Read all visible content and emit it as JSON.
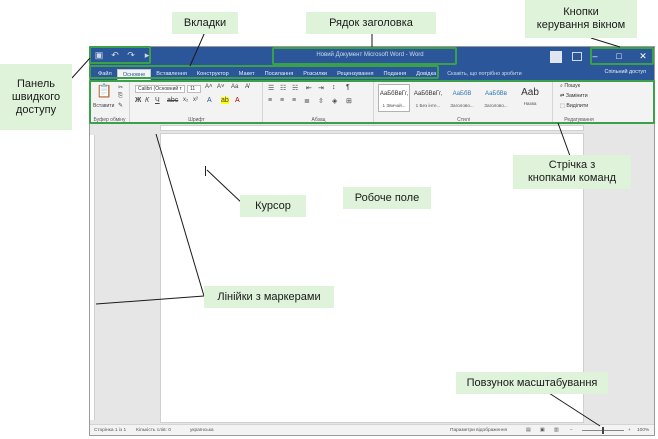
{
  "window": {
    "title": "Новий Документ Microsoft Word  -  Word",
    "tell_me": "Скажіть, що потрібно зробити",
    "share": "Спільний доступ"
  },
  "tabs": [
    "Файл",
    "Основне",
    "Вставлення",
    "Конструктор",
    "Макет",
    "Посилання",
    "Розсилки",
    "Рецензування",
    "Подання",
    "Довідка"
  ],
  "ribbon": {
    "paste_label": "Вставити",
    "font_name": "Calibri (Основний т",
    "font_size": "11",
    "groups": [
      "Буфер обміну",
      "Шрифт",
      "Абзац",
      "Стилі",
      "Редагування"
    ],
    "styles": [
      {
        "preview": "АаБбВвГг,",
        "name": "1 Звичай..."
      },
      {
        "preview": "АаБбВвГг,",
        "name": "1 Без інте..."
      },
      {
        "preview": "АаБбВ",
        "name": "Заголово..."
      },
      {
        "preview": "АаБбВв",
        "name": "Заголово..."
      },
      {
        "preview": "Aab",
        "name": "Назва"
      }
    ],
    "edit": [
      "Пошук",
      "Замінити",
      "Виділити"
    ]
  },
  "status": {
    "page": "Сторінка 1 із 1",
    "words": "Кількість слів: 0",
    "lang": "українська",
    "display": "Параметри відображення",
    "zoom": "100%"
  },
  "callouts": {
    "qat": "Панель\nшвидкого\nдоступу",
    "tabs": "Вкладки",
    "titlebar": "Рядок заголовка",
    "wctl": "Кнопки\nкерування вікном",
    "ribbon": "Стрічка з\nкнопками команд",
    "cursor": "Курсор",
    "workarea": "Робоче поле",
    "rulers": "Лінійки з маркерами",
    "zoom": "Повзунок масштабування"
  }
}
